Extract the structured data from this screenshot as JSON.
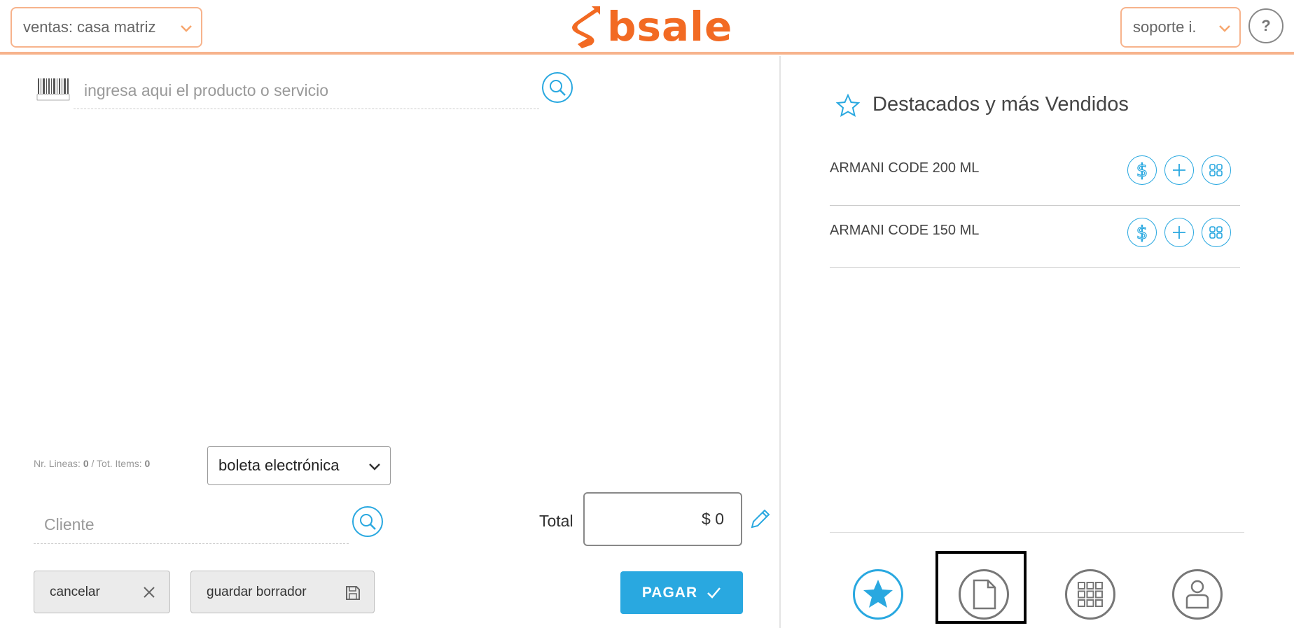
{
  "header": {
    "branch_select": "ventas: casa matriz",
    "brand": "bsale",
    "user_select": "soporte i.",
    "help_label": "?"
  },
  "sale": {
    "product_placeholder": "ingresa aqui el producto o servicio",
    "lines_label": "Nr. Lineas:",
    "lines_value": "0",
    "items_label": "/ Tot. Items:",
    "items_value": "0",
    "document_type": "boleta electrónica",
    "client_placeholder": "Cliente",
    "total_label": "Total",
    "total_value": "$ 0",
    "cancel_label": "cancelar",
    "draft_label": "guardar borrador",
    "pay_label": "PAGAR"
  },
  "favorites": {
    "title": "Destacados y más Vendidos",
    "items": [
      {
        "name": "ARMANI CODE 200 ML"
      },
      {
        "name": "ARMANI CODE 150 ML"
      }
    ]
  },
  "colors": {
    "accent": "#29a8e0",
    "brand": "#f26a23",
    "header_border": "#f7b38c"
  },
  "icons": {
    "nav": [
      "star-icon",
      "document-icon",
      "grid-icon",
      "user-icon"
    ]
  }
}
